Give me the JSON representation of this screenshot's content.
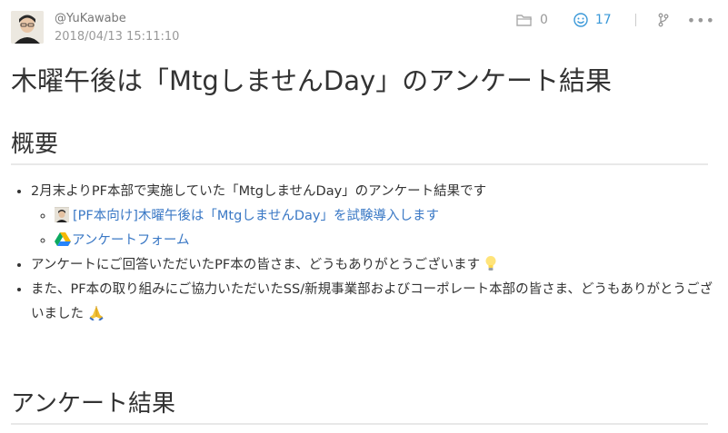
{
  "post": {
    "username": "@YuKawabe",
    "date": "2018/04/13 15:11:10",
    "title": "木曜午後は「MtgしませんDay」のアンケート結果"
  },
  "meta": {
    "folder_count": "0",
    "like_count": "17"
  },
  "sections": {
    "overview": "概要",
    "results": "アンケート結果"
  },
  "list": {
    "item1": "2月末よりPF本部で実施していた「MtgしませんDay」のアンケート結果です",
    "sub1": "[PF本向け]木曜午後は「MtgしませんDay」を試験導入します",
    "sub2": "アンケートフォーム",
    "item2": "アンケートにご回答いただいたPF本の皆さま、どうもありがとうございます",
    "item3": "また、PF本の取り組みにご協力いただいたSS/新規事業部およびコーポレート本部の皆さま、どうもありがとうございました"
  },
  "colors": {
    "link": "#3a78c5",
    "like": "#3a98d8",
    "rule": "#e8e8e8"
  },
  "icons": [
    "folder-icon",
    "smiley-icon",
    "branch-icon",
    "more-icon",
    "google-drive-icon",
    "lightbulb-emoji",
    "pray-emoji"
  ]
}
